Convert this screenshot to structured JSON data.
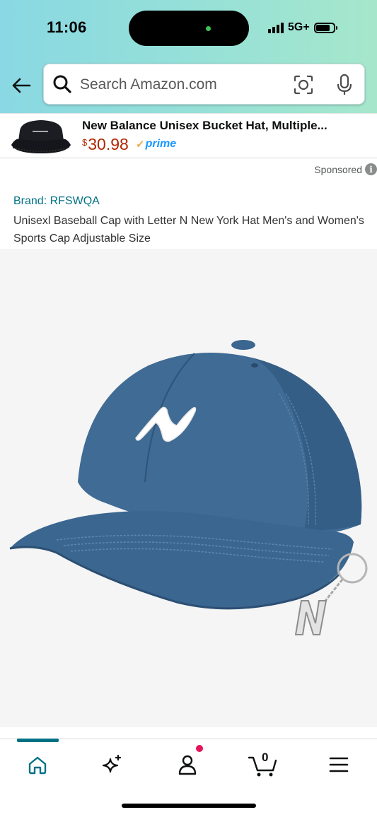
{
  "status_bar": {
    "time": "11:06",
    "network": "5G+"
  },
  "search": {
    "placeholder": "Search Amazon.com",
    "icons": [
      "back-arrow-icon",
      "search-icon",
      "camera-lens-icon",
      "microphone-icon"
    ]
  },
  "sponsored_ad": {
    "title": "New Balance Unisex Bucket Hat, Multiple...",
    "price_currency": "$",
    "price_amount": "30.98",
    "prime_label": "prime",
    "sponsored_label": "Sponsored"
  },
  "product": {
    "brand": "Brand: RFSWQA",
    "title": "Unisexl Baseball Cap with Letter N New York Hat Men's and Women's Sports Cap Adjustable Size"
  },
  "bottom_nav": {
    "items": [
      "home-icon",
      "ai-sparkle-icon",
      "account-icon",
      "cart-icon",
      "menu-icon"
    ],
    "cart_count": "0"
  },
  "colors": {
    "link": "#007185",
    "price": "#b12704",
    "prime": "#1a98ff",
    "cap_blue": "#3f6b95"
  }
}
